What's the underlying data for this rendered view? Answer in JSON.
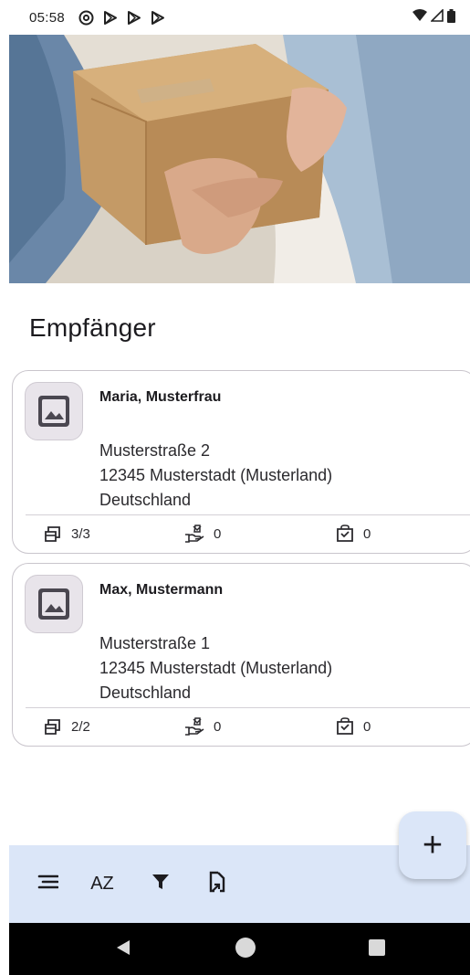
{
  "status_bar": {
    "time": "05:58"
  },
  "page": {
    "title": "Empfänger"
  },
  "recipients": [
    {
      "name": "Maria, Musterfrau",
      "street": "Musterstraße 2",
      "city": "12345 Musterstadt (Musterland)",
      "country": "Deutschland",
      "stats": {
        "shipments": "3/3",
        "handovers": "0",
        "packages": "0"
      }
    },
    {
      "name": "Max, Mustermann",
      "street": "Musterstraße 1",
      "city": "12345 Musterstadt (Musterland)",
      "country": "Deutschland",
      "stats": {
        "shipments": "2/2",
        "handovers": "0",
        "packages": "0"
      }
    }
  ],
  "fab": {
    "label": "+"
  },
  "toolbar": {
    "sort_label": "AZ"
  },
  "colors": {
    "accent_container": "#dbe6f8",
    "card_border": "#c9c5cc",
    "nav_bar": "#000000"
  },
  "icons": [
    "wifi-icon",
    "signal-icon",
    "battery-icon",
    "menu-icon",
    "sort-az-icon",
    "filter-icon",
    "export-icon",
    "image-placeholder-icon",
    "shipment-icon",
    "handover-icon",
    "package-icon",
    "back-icon",
    "home-icon",
    "recents-icon"
  ]
}
